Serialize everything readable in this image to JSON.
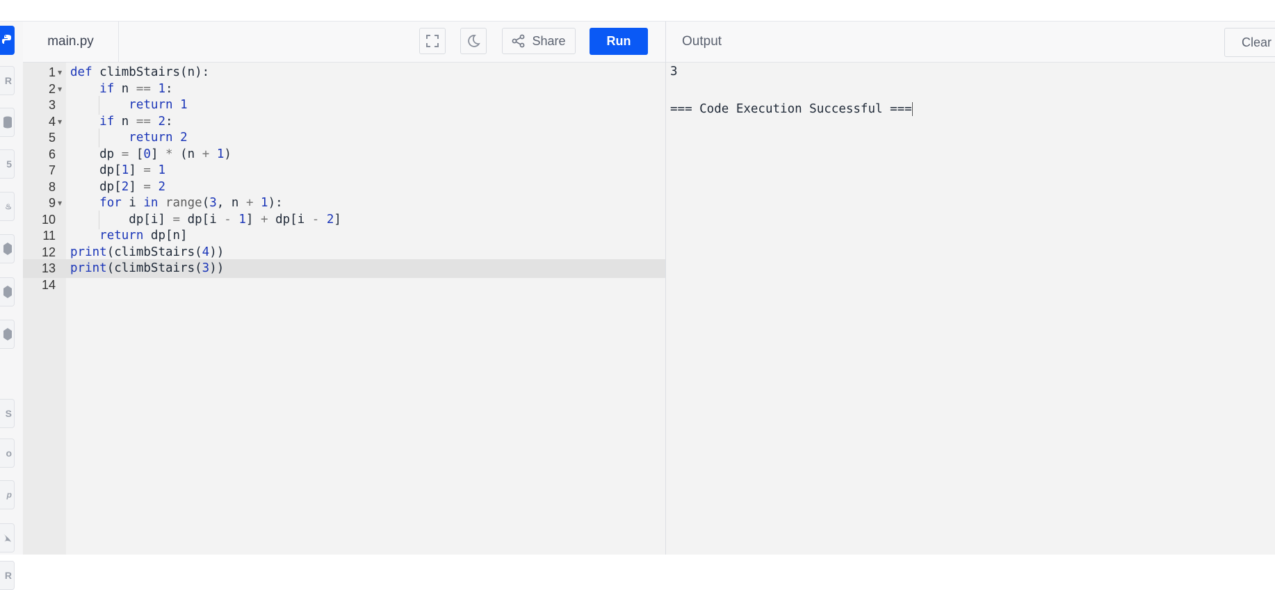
{
  "editor": {
    "file_tab": "main.py",
    "toolbar": {
      "fullscreen_icon": "fullscreen-icon",
      "theme_icon": "moon-icon",
      "share_label": "Share",
      "run_label": "Run"
    },
    "lines": [
      {
        "n": "1",
        "fold": true
      },
      {
        "n": "2",
        "fold": true
      },
      {
        "n": "3",
        "fold": false
      },
      {
        "n": "4",
        "fold": true
      },
      {
        "n": "5",
        "fold": false
      },
      {
        "n": "6",
        "fold": false
      },
      {
        "n": "7",
        "fold": false
      },
      {
        "n": "8",
        "fold": false
      },
      {
        "n": "9",
        "fold": true
      },
      {
        "n": "10",
        "fold": false
      },
      {
        "n": "11",
        "fold": false
      },
      {
        "n": "12",
        "fold": false
      },
      {
        "n": "13",
        "fold": false
      },
      {
        "n": "14",
        "fold": false
      }
    ],
    "code": [
      "def climbStairs(n):",
      "    if n == 1:",
      "        return 1",
      "    if n == 2:",
      "        return 2",
      "    dp = [0] * (n + 1)",
      "    dp[1] = 1",
      "    dp[2] = 2",
      "    for i in range(3, n + 1):",
      "        dp[i] = dp[i - 1] + dp[i - 2]",
      "    return dp[n]",
      "print(climbStairs(4))",
      "print(climbStairs(3))",
      ""
    ],
    "active_line": "13"
  },
  "output": {
    "title": "Output",
    "clear_label": "Clear",
    "lines": [
      "3",
      "",
      "=== Code Execution Successful ==="
    ]
  },
  "sidebar": {
    "items": [
      {
        "icon": "python-icon",
        "active": true
      },
      {
        "icon": "r-icon"
      },
      {
        "icon": "database-icon"
      },
      {
        "icon": "html5-icon"
      },
      {
        "icon": "java-icon"
      },
      {
        "icon": "cplusplus-icon"
      },
      {
        "icon": "c-icon"
      },
      {
        "icon": "csharp-icon"
      },
      {
        "icon": "javascript-icon"
      },
      {
        "icon": "go-icon"
      },
      {
        "icon": "php-icon"
      },
      {
        "icon": "swift-icon"
      },
      {
        "icon": "rust-icon"
      }
    ],
    "colors": {
      "accent": "#0a59f5",
      "inactive": "#9aa0ab"
    }
  },
  "colors": {
    "accent": "#0a59f5",
    "editor_bg": "#f3f3f3",
    "keyword": "#1b36b8"
  }
}
